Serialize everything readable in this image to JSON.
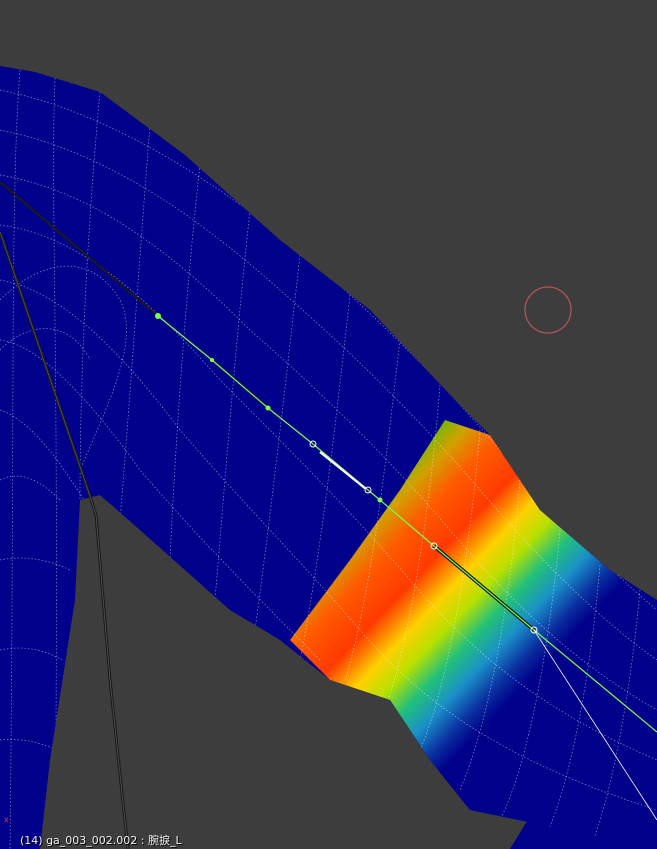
{
  "viewport": {
    "mode": "Weight Paint",
    "background_color": "#3d3d3d",
    "mesh_base_color": "#00008a",
    "wire_color": "#ffffff",
    "bone_active_color": "#7cff4a",
    "bone_inactive_color": "#1a1a1a",
    "cursor_color": "#b85555",
    "gradient_colors": [
      "#00008a",
      "#1b8fc8",
      "#22c070",
      "#e0e000",
      "#ff6a00",
      "#ff3200"
    ],
    "status_text": "(14) ga_003_002.002 : 腕捩_L",
    "axis_label": "x"
  }
}
